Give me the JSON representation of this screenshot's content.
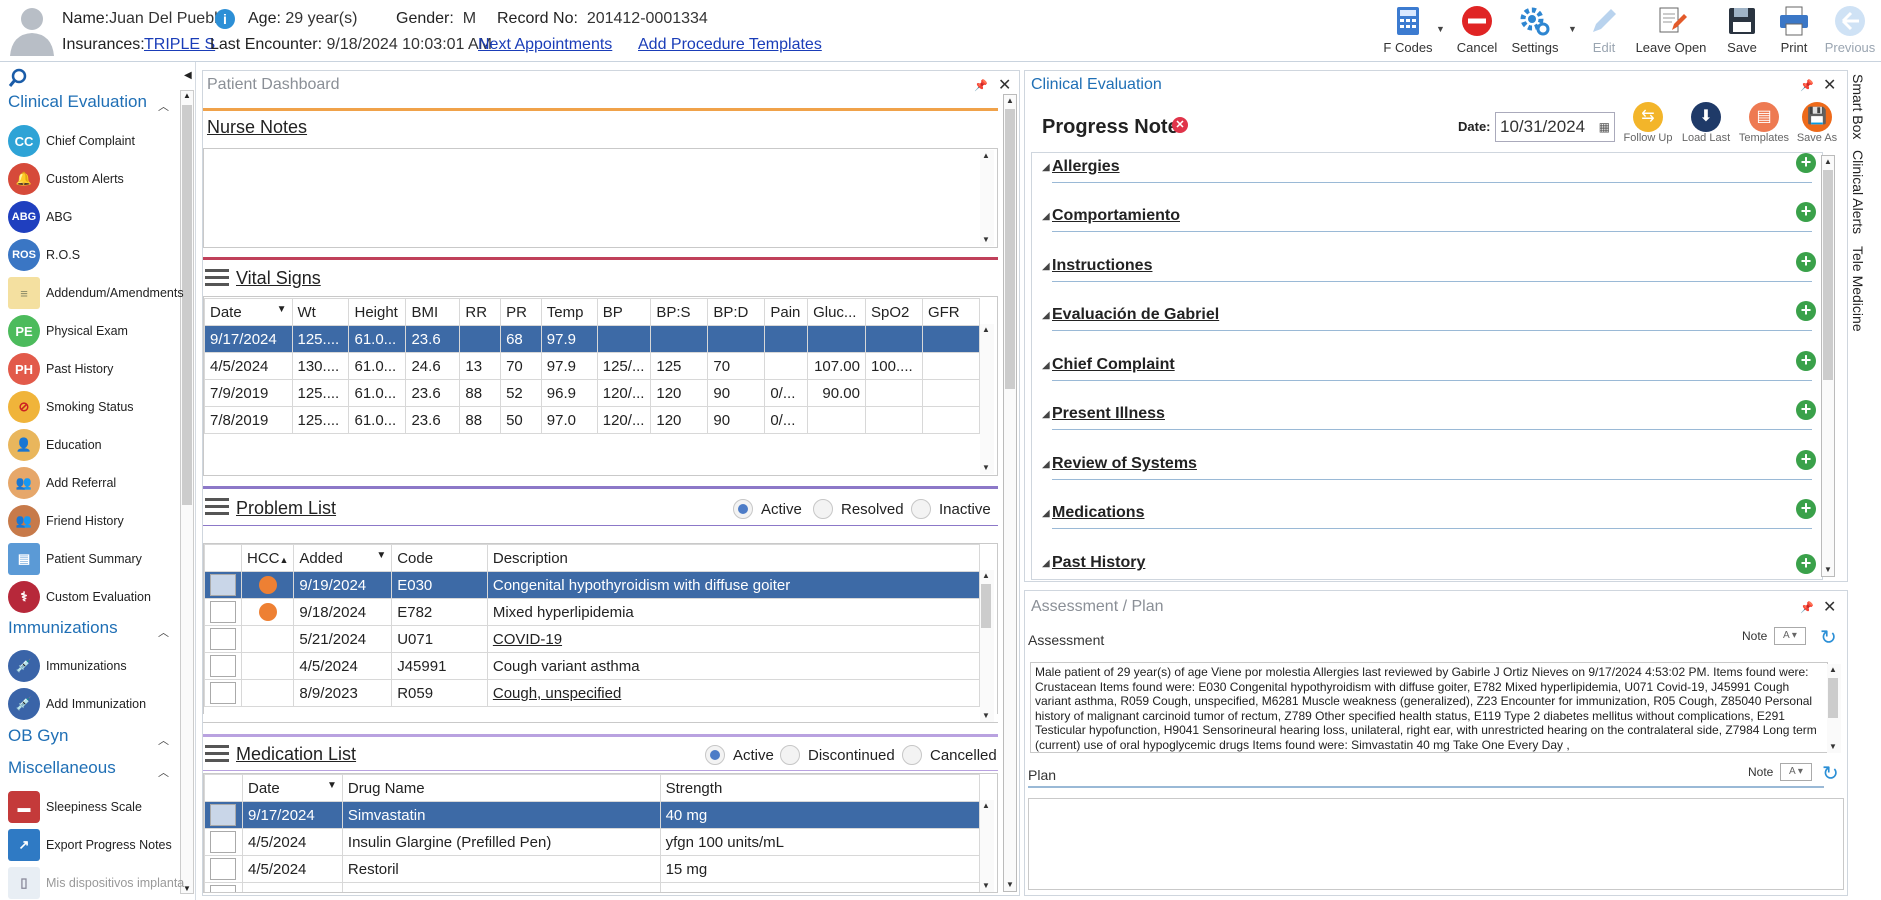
{
  "header": {
    "name_label": "Name:",
    "name_value": "Juan Del Pueblo",
    "age_label": "Age:",
    "age_value": "29 year(s)",
    "gender_label": "Gender:",
    "gender_value": "M",
    "record_label": "Record No:",
    "record_value": "201412-0001334",
    "insurances_label": "Insurances:",
    "insurance_value": "TRIPLE S",
    "last_enc_label": "Last Encounter:",
    "last_enc_value": "9/18/2024 10:03:01 AM",
    "next_appointments": "Next Appointments",
    "add_procedure_templates": "Add Procedure Templates"
  },
  "toolbar": {
    "fcodes": "F Codes",
    "cancel": "Cancel",
    "settings": "Settings",
    "edit": "Edit",
    "leave_open": "Leave Open",
    "save": "Save",
    "print": "Print",
    "previous": "Previous"
  },
  "sidebar": {
    "sections": {
      "clinical_evaluation": "Clinical Evaluation",
      "immunizations": "Immunizations",
      "ob_gyn": "OB Gyn",
      "miscellaneous": "Miscellaneous"
    },
    "clinical_items": [
      {
        "label": "Chief Complaint",
        "icon": "CC"
      },
      {
        "label": "Custom Alerts",
        "icon": ""
      },
      {
        "label": "ABG",
        "icon": "ABG"
      },
      {
        "label": "R.O.S",
        "icon": "ROS"
      },
      {
        "label": "Addendum/Amendments",
        "icon": ""
      },
      {
        "label": "Physical Exam",
        "icon": "PE"
      },
      {
        "label": "Past History",
        "icon": "PH"
      },
      {
        "label": "Smoking Status",
        "icon": ""
      },
      {
        "label": "Education",
        "icon": ""
      },
      {
        "label": "Add Referral",
        "icon": ""
      },
      {
        "label": "Friend History",
        "icon": ""
      },
      {
        "label": "Patient Summary",
        "icon": ""
      },
      {
        "label": "Custom Evaluation",
        "icon": ""
      }
    ],
    "immunization_items": [
      {
        "label": "Immunizations"
      },
      {
        "label": "Add Immunization"
      }
    ],
    "misc_items": [
      {
        "label": "Sleepiness Scale"
      },
      {
        "label": "Export Progress Notes"
      },
      {
        "label": "Mis dispositivos implanta"
      }
    ]
  },
  "dashboard": {
    "title": "Patient Dashboard",
    "nurse_notes": "Nurse Notes",
    "vital_signs": "Vital Signs",
    "vitals_headers": [
      "Date",
      "Wt",
      "Height",
      "BMI",
      "RR",
      "PR",
      "Temp",
      "BP",
      "BP:S",
      "BP:D",
      "Pain",
      "Gluc...",
      "SpO2",
      "GFR"
    ],
    "vitals_rows": [
      [
        "9/17/2024",
        "125....",
        "61.0...",
        "23.6",
        "",
        "68",
        "97.9",
        "",
        "",
        "",
        "",
        "",
        "",
        ""
      ],
      [
        "4/5/2024",
        "130....",
        "61.0...",
        "24.6",
        "13",
        "70",
        "97.9",
        "125/...",
        "125",
        "70",
        "",
        "107.00",
        "100....",
        ""
      ],
      [
        "7/9/2019",
        "125....",
        "61.0...",
        "23.6",
        "88",
        "52",
        "96.9",
        "120/...",
        "120",
        "90",
        "0/...",
        "90.00",
        "",
        ""
      ],
      [
        "7/8/2019",
        "125....",
        "61.0...",
        "23.6",
        "88",
        "50",
        "97.0",
        "120/...",
        "120",
        "90",
        "0/...",
        "",
        "",
        ""
      ]
    ],
    "problem_list": "Problem List",
    "problem_filters": [
      "Active",
      "Resolved",
      "Inactive"
    ],
    "problem_headers": [
      "HCC",
      "Added",
      "Code",
      "Description"
    ],
    "problem_rows": [
      {
        "hcc": true,
        "added": "9/19/2024",
        "code": "E030",
        "desc": "Congenital hypothyroidism with diffuse goiter",
        "link": false
      },
      {
        "hcc": true,
        "added": "9/18/2024",
        "code": "E782",
        "desc": "Mixed hyperlipidemia",
        "link": false
      },
      {
        "hcc": false,
        "added": "5/21/2024",
        "code": "U071",
        "desc": "COVID-19",
        "link": true
      },
      {
        "hcc": false,
        "added": "4/5/2024",
        "code": "J45991",
        "desc": "Cough variant asthma",
        "link": false
      },
      {
        "hcc": false,
        "added": "8/9/2023",
        "code": "R059",
        "desc": "Cough, unspecified",
        "link": true
      }
    ],
    "medication_list": "Medication List",
    "med_filters": [
      "Active",
      "Discontinued",
      "Cancelled"
    ],
    "med_headers": [
      "Date",
      "Drug Name",
      "Strength"
    ],
    "med_rows": [
      [
        "9/17/2024",
        "Simvastatin",
        "40 mg"
      ],
      [
        "4/5/2024",
        "Insulin Glargine (Prefilled Pen)",
        "yfgn 100 units/mL"
      ],
      [
        "4/5/2024",
        "Restoril",
        "15 mg"
      ]
    ]
  },
  "clinical": {
    "title": "Clinical Evaluation",
    "progress_note": "Progress Note",
    "date_label": "Date:",
    "date_value": "10/31/2024",
    "actions": [
      "Follow Up",
      "Load Last",
      "Templates",
      "Save As"
    ],
    "sections": [
      "Allergies",
      "Comportamiento",
      "Instructiones",
      "Evaluación de Gabriel",
      "Chief Complaint",
      "Present Illness",
      "Review of Systems",
      "Medications",
      "Past History"
    ]
  },
  "side_tabs": [
    "Smart Box",
    "Clinical Alerts",
    "Tele Medicine"
  ],
  "assessment_plan": {
    "title": "Assessment / Plan",
    "assessment_label": "Assessment",
    "note_label": "Note",
    "assessment_text": "Male patient of 29 year(s) of age Viene por molestia    Allergies last reviewed by Gabirle J Ortiz Nieves on 9/17/2024 4:53:02 PM.    Items found were:  Crustacean  Items found were:  E030 Congenital hypothyroidism with diffuse goiter, E782 Mixed hyperlipidemia, U071 Covid-19, J45991 Cough variant asthma, R059 Cough, unspecified, M6281 Muscle weakness (generalized), Z23 Encounter for immunization, R05 Cough, Z85040 Personal history of malignant carcinoid tumor of rectum, Z789 Other specified health status, E119 Type 2 diabetes mellitus without complications, E291 Testicular hypofunction, H9041 Sensorineural hearing loss, unilateral, right ear, with unrestricted hearing on the contralateral side, Z7984 Long term (current) use of oral hypoglycemic drugs  Items found were:  Simvastatin 40 mg Take One Every Day ,",
    "plan_label": "Plan"
  },
  "colors": {
    "accent_blue": "#1f6fb5",
    "selected_row": "#3d6aa6",
    "nurse_line": "#f0a24a",
    "vitals_line": "#c0405a",
    "problem_line": "#8c78c8",
    "med_line": "#b9a2e0",
    "hcc_dot": "#ee8033",
    "add_green": "#3aa14a"
  }
}
